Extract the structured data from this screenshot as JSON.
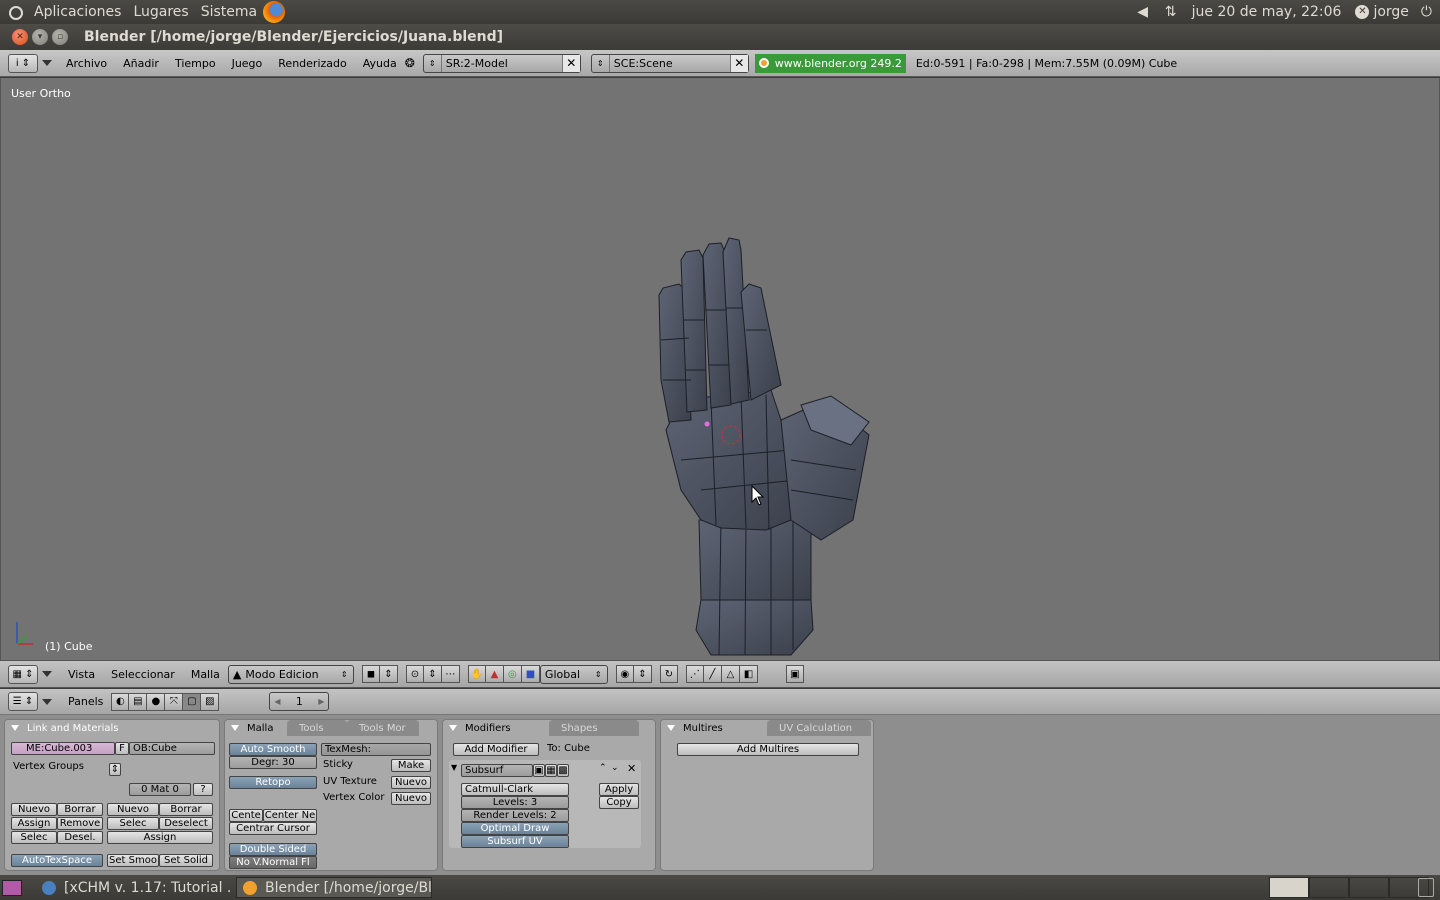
{
  "gnome": {
    "menus": [
      "Aplicaciones",
      "Lugares",
      "Sistema"
    ],
    "clock": "jue 20 de may, 22:06",
    "user": "jorge"
  },
  "window": {
    "title": "Blender [/home/jorge/Blender/Ejercicios/Juana.blend]"
  },
  "header": {
    "menus": [
      "Archivo",
      "Añadir",
      "Tiempo",
      "Juego",
      "Renderizado",
      "Ayuda"
    ],
    "screen": "SR:2-Model",
    "scene": "SCE:Scene",
    "url": "www.blender.org 249.2",
    "stats": "Ed:0-591 | Fa:0-298 | Mem:7.55M (0.09M) Cube"
  },
  "viewport": {
    "label": "User Ortho",
    "object": "(1) Cube"
  },
  "view_header": {
    "menus": [
      "Vista",
      "Seleccionar",
      "Malla"
    ],
    "mode": "Modo Edicion",
    "orientation": "Global"
  },
  "buttons_header": {
    "panels_label": "Panels",
    "frame": "1"
  },
  "link_materials": {
    "title": "Link and Materials",
    "mesh": "ME:Cube.003",
    "f": "F",
    "object": "OB:Cube",
    "vertex_groups": "Vertex Groups",
    "mat": "0 Mat 0",
    "q": "?",
    "left_buttons": [
      "Nuevo",
      "Borrar",
      "Assign",
      "Remove",
      "Selec",
      "Desel."
    ],
    "right_buttons": [
      "Nuevo",
      "Borrar",
      "Selec",
      "Deselect",
      "Assign"
    ],
    "autotex": "AutoTexSpace",
    "set_smooth": "Set Smoo",
    "set_solid": "Set Solid"
  },
  "malla": {
    "tabs": [
      "Malla",
      "Tools",
      "Tools Mor"
    ],
    "auto_smooth": "Auto Smooth",
    "degr": "Degr: 30",
    "retopo": "Retopo",
    "cente": "Cente",
    "center_ne": "Center Ne",
    "centrar_cursor": "Centrar Cursor",
    "double_sided": "Double Sided",
    "no_vnormal": "No V.Normal Fl",
    "texmesh": "TexMesh:",
    "sticky": "Sticky",
    "make": "Make",
    "uv_texture": "UV Texture",
    "vertex_color": "Vertex Color",
    "nuevo": "Nuevo"
  },
  "modifiers": {
    "tabs": [
      "Modifiers",
      "Shapes"
    ],
    "add_modifier": "Add Modifier",
    "to": "To: Cube",
    "subsurf_name": "Subsurf",
    "type": "Catmull-Clark",
    "levels": "Levels: 3",
    "render_levels": "Render Levels: 2",
    "optimal_draw": "Optimal Draw",
    "subsurf_uv": "Subsurf UV",
    "apply": "Apply",
    "copy": "Copy"
  },
  "multires": {
    "tabs": [
      "Multires",
      "UV Calculation"
    ],
    "add": "Add Multires"
  },
  "taskbar": {
    "tasks": [
      "[xCHM v. 1.17: Tutorial ...",
      "Blender [/home/jorge/Bl..."
    ]
  }
}
